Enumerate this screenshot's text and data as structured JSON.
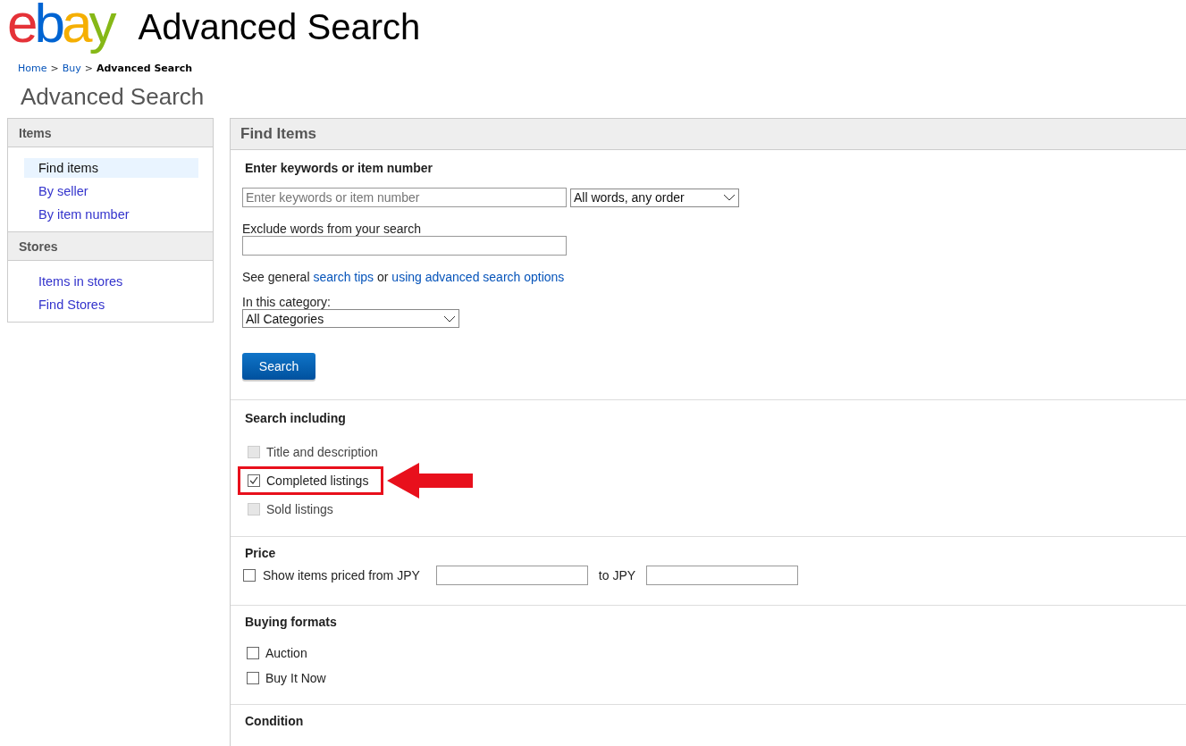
{
  "header": {
    "logo": "ebay",
    "title": "Advanced Search"
  },
  "breadcrumb": [
    {
      "label": "Home",
      "current": false
    },
    {
      "label": "Buy",
      "current": false
    },
    {
      "label": "Advanced Search",
      "current": true
    }
  ],
  "breadcrumb_separator": ">",
  "page_title": "Advanced Search",
  "sidebar": {
    "groups": [
      {
        "title": "Items",
        "items": [
          {
            "label": "Find items",
            "selected": true
          },
          {
            "label": "By seller",
            "selected": false
          },
          {
            "label": "By item number",
            "selected": false
          }
        ]
      },
      {
        "title": "Stores",
        "items": [
          {
            "label": "Items in stores",
            "selected": false
          },
          {
            "label": "Find Stores",
            "selected": false
          }
        ]
      }
    ]
  },
  "panel": {
    "title": "Find Items",
    "keywords": {
      "heading": "Enter keywords or item number",
      "placeholder": "Enter keywords or item number",
      "match_select": "All words, any order"
    },
    "exclude": {
      "label": "Exclude words from your search"
    },
    "tips": {
      "prefix": "See general",
      "link1": "search tips",
      "middle": "or",
      "link2": "using advanced search options"
    },
    "category": {
      "label": "In this category:",
      "value": "All Categories"
    },
    "search_button": "Search",
    "search_including": {
      "heading": "Search including",
      "options": [
        {
          "label": "Title and description",
          "checked": false,
          "disabled": true,
          "highlighted": false
        },
        {
          "label": "Completed listings",
          "checked": true,
          "disabled": false,
          "highlighted": true
        },
        {
          "label": "Sold listings",
          "checked": false,
          "disabled": true,
          "highlighted": false
        }
      ]
    },
    "price": {
      "heading": "Price",
      "checked": false,
      "from_label": "Show items priced from JPY",
      "to_label": "to JPY"
    },
    "buying_formats": {
      "heading": "Buying formats",
      "options": [
        {
          "label": "Auction",
          "checked": false
        },
        {
          "label": "Buy It Now",
          "checked": false
        }
      ]
    },
    "condition": {
      "heading": "Condition"
    }
  }
}
